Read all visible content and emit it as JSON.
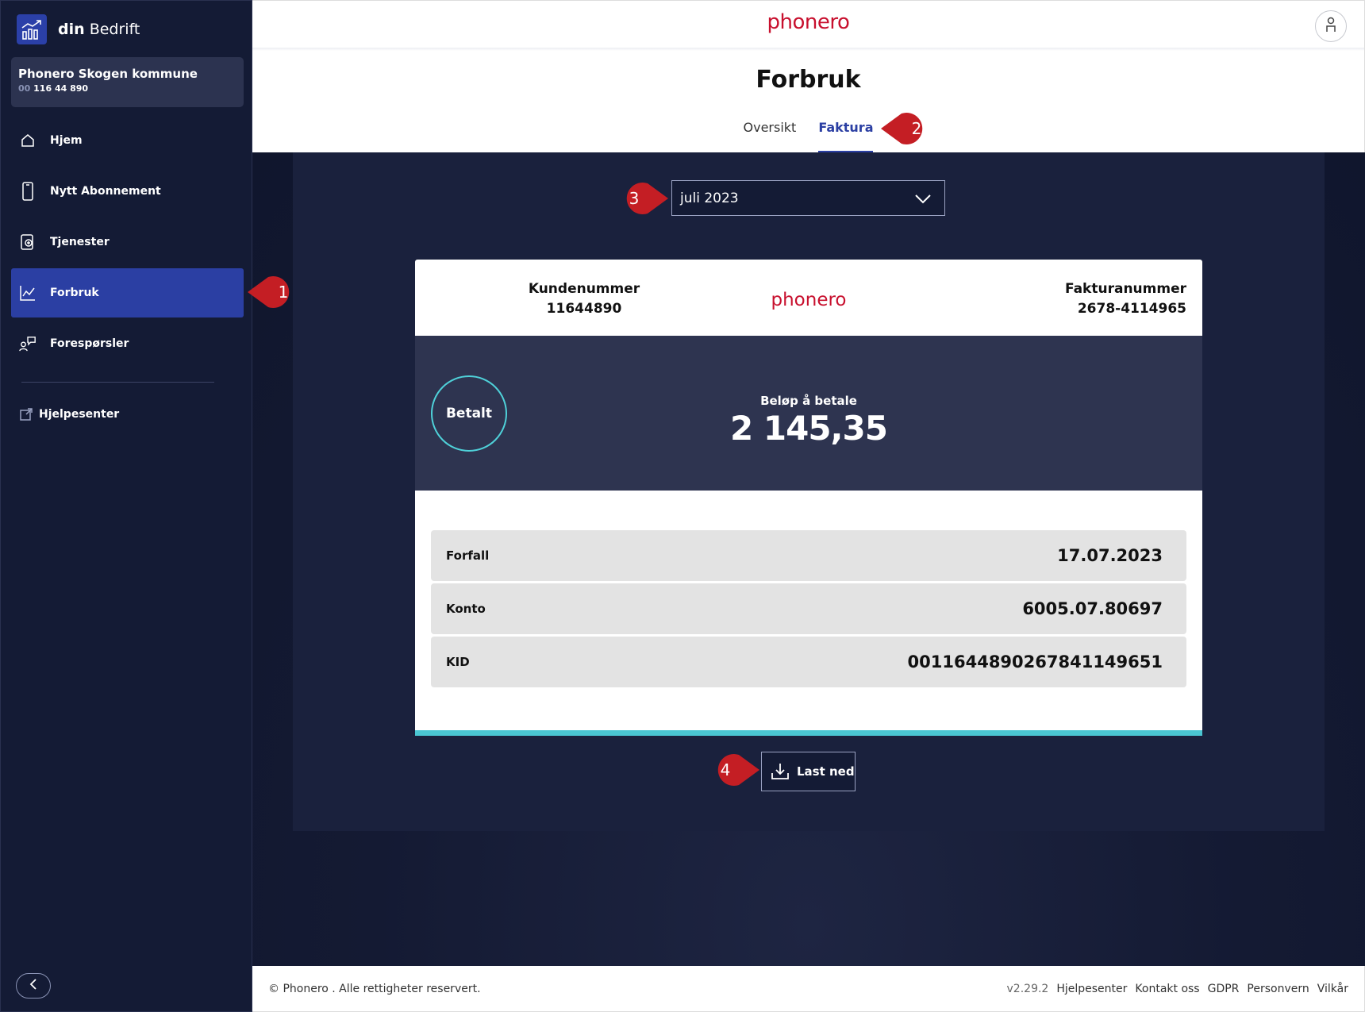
{
  "sidebar": {
    "brand": {
      "prefix": "din",
      "suffix": "Bedrift"
    },
    "org": {
      "name": "Phonero Skogen kommune",
      "number_prefix": "00",
      "number": "116 44 890"
    },
    "items": [
      {
        "label": "Hjem",
        "icon": "home-icon"
      },
      {
        "label": "Nytt Abonnement",
        "icon": "phone-icon"
      },
      {
        "label": "Tjenester",
        "icon": "services-icon"
      },
      {
        "label": "Forbruk",
        "icon": "usage-chart-icon",
        "active": true
      },
      {
        "label": "Forespørsler",
        "icon": "requests-icon"
      }
    ],
    "help": {
      "label": "Hjelpesenter",
      "icon": "external-link-icon"
    }
  },
  "header": {
    "logo": "phonero",
    "title": "Forbruk",
    "tabs": [
      {
        "label": "Oversikt",
        "active": false
      },
      {
        "label": "Faktura",
        "active": true
      }
    ]
  },
  "invoice": {
    "month_selected": "juli 2023",
    "customer_label": "Kundenummer",
    "customer_number": "11644890",
    "logo": "phonero",
    "invoice_label": "Fakturanummer",
    "invoice_number": "2678-4114965",
    "status": "Betalt",
    "amount_label": "Beløp å betale",
    "amount": "2 145,35",
    "rows": [
      {
        "key": "Forfall",
        "value": "17.07.2023"
      },
      {
        "key": "Konto",
        "value": "6005.07.80697"
      },
      {
        "key": "KID",
        "value": "001164489026784114965​1"
      }
    ],
    "download_label": "Last ned"
  },
  "footer": {
    "copyright": "© Phonero . Alle rettigheter reservert.",
    "version": "v2.29.2",
    "links": [
      "Hjelpesenter",
      "Kontakt oss",
      "GDPR",
      "Personvern",
      "Vilkår"
    ]
  },
  "callouts": [
    "1",
    "2",
    "3",
    "4"
  ],
  "colors": {
    "sidebar_bg": "#141b35",
    "active_nav": "#2b3fa3",
    "brand_red": "#c8102e",
    "accent_teal": "#4ac6d2",
    "callout_red": "#c41e24"
  }
}
